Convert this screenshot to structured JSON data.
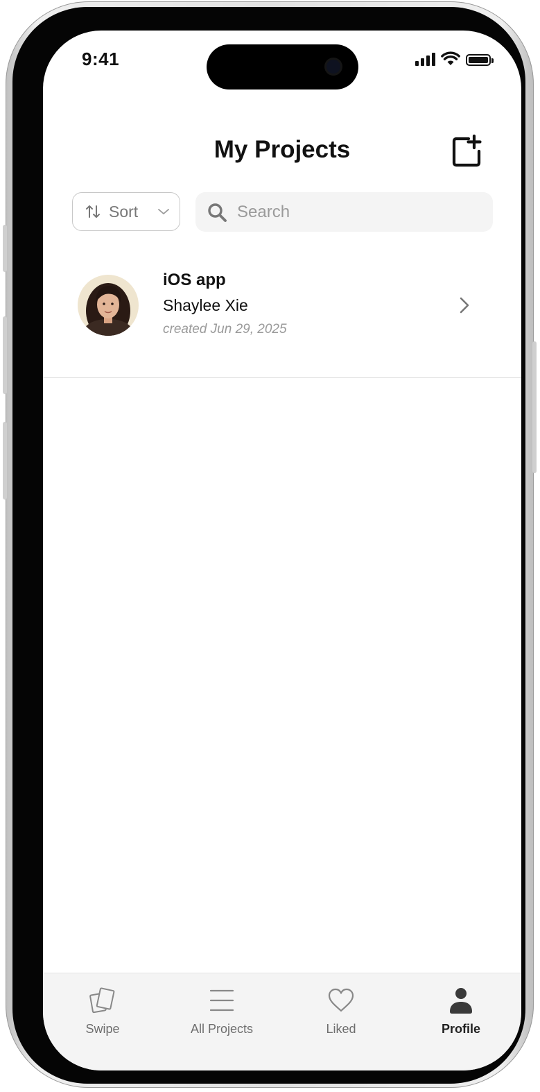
{
  "status_bar": {
    "time": "9:41"
  },
  "header": {
    "title": "My Projects",
    "new_project_icon": "new-project-icon"
  },
  "toolbar": {
    "sort_label": "Sort",
    "search_placeholder": "Search"
  },
  "projects": [
    {
      "title": "iOS app",
      "owner": "Shaylee Xie",
      "created": "created Jun 29, 2025"
    }
  ],
  "tabs": [
    {
      "label": "Swipe",
      "icon": "cards-icon",
      "active": false
    },
    {
      "label": "All Projects",
      "icon": "list-icon",
      "active": false
    },
    {
      "label": "Liked",
      "icon": "heart-icon",
      "active": false
    },
    {
      "label": "Profile",
      "icon": "person-icon",
      "active": true
    }
  ]
}
